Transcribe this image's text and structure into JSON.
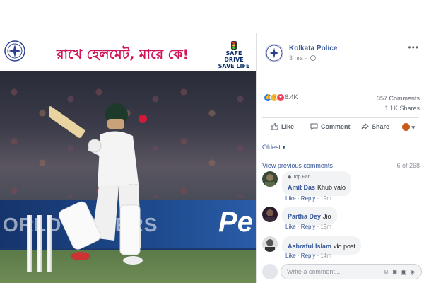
{
  "banner": {
    "headline": "রাখে হেলমেট, মারে কে!",
    "safe_drive_line1": "SAFE DRIVE",
    "safe_drive_line2": "SAVE LIFE"
  },
  "photo": {
    "hoarding_text": "ORLD MAKERS",
    "hoarding_brand": "Pe"
  },
  "post": {
    "page_name": "Kolkata Police",
    "time": "3 hrs ·",
    "reaction_icons": [
      "like-icon",
      "haha-icon",
      "love-icon"
    ],
    "reaction_count": "6.4K",
    "comments_count": "357 Comments",
    "shares_count": "1.1K Shares"
  },
  "actions": {
    "like": "Like",
    "comment": "Comment",
    "share": "Share"
  },
  "comments_section": {
    "sort": "Oldest",
    "view_previous": "View previous comments",
    "count": "6 of 268",
    "items": [
      {
        "badge": "Top Fan",
        "name": "Amit Das",
        "text": "Khub valo",
        "like": "Like",
        "reply": "Reply",
        "time": "19m"
      },
      {
        "badge": "",
        "name": "Partha Dey",
        "text": "Jio",
        "like": "Like",
        "reply": "Reply",
        "time": "19m"
      },
      {
        "badge": "",
        "name": "Ashraful Islam",
        "text": "vlo post",
        "like": "Like",
        "reply": "Reply",
        "time": "14m"
      }
    ],
    "composer_placeholder": "Write a comment..."
  },
  "colors": {
    "link": "#385898",
    "headline": "#d2145a",
    "like_blue": "#1877f2"
  }
}
